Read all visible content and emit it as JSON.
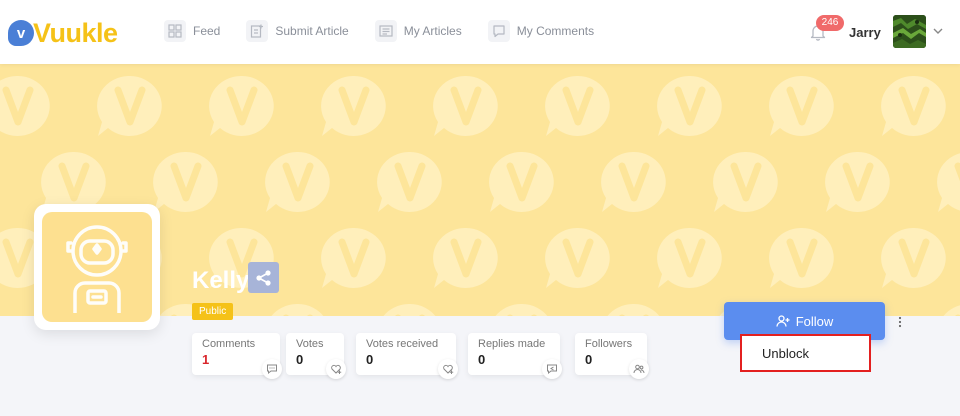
{
  "brand": {
    "name": "Vuukle",
    "mark": "v"
  },
  "nav": {
    "items": [
      {
        "label": "Feed"
      },
      {
        "label": "Submit Article"
      },
      {
        "label": "My Articles"
      },
      {
        "label": "My Comments"
      }
    ]
  },
  "header": {
    "notifications_count": "246",
    "username": "Jarry"
  },
  "profile": {
    "name": "Kelly",
    "visibility": "Public",
    "stats": [
      {
        "label": "Comments",
        "value": "1"
      },
      {
        "label": "Votes",
        "value": "0"
      },
      {
        "label": "Votes received",
        "value": "0"
      },
      {
        "label": "Replies made",
        "value": "0"
      },
      {
        "label": "Followers",
        "value": "0"
      }
    ],
    "follow_label": "Follow",
    "menu": {
      "items": [
        {
          "label": "Unblock"
        }
      ]
    }
  },
  "colors": {
    "brand_yellow": "#f5c218",
    "brand_blue": "#4a7fd6",
    "banner": "#fde59a",
    "follow_button": "#5b8def",
    "badge": "#f06a6a",
    "highlight_border": "#e32020"
  }
}
